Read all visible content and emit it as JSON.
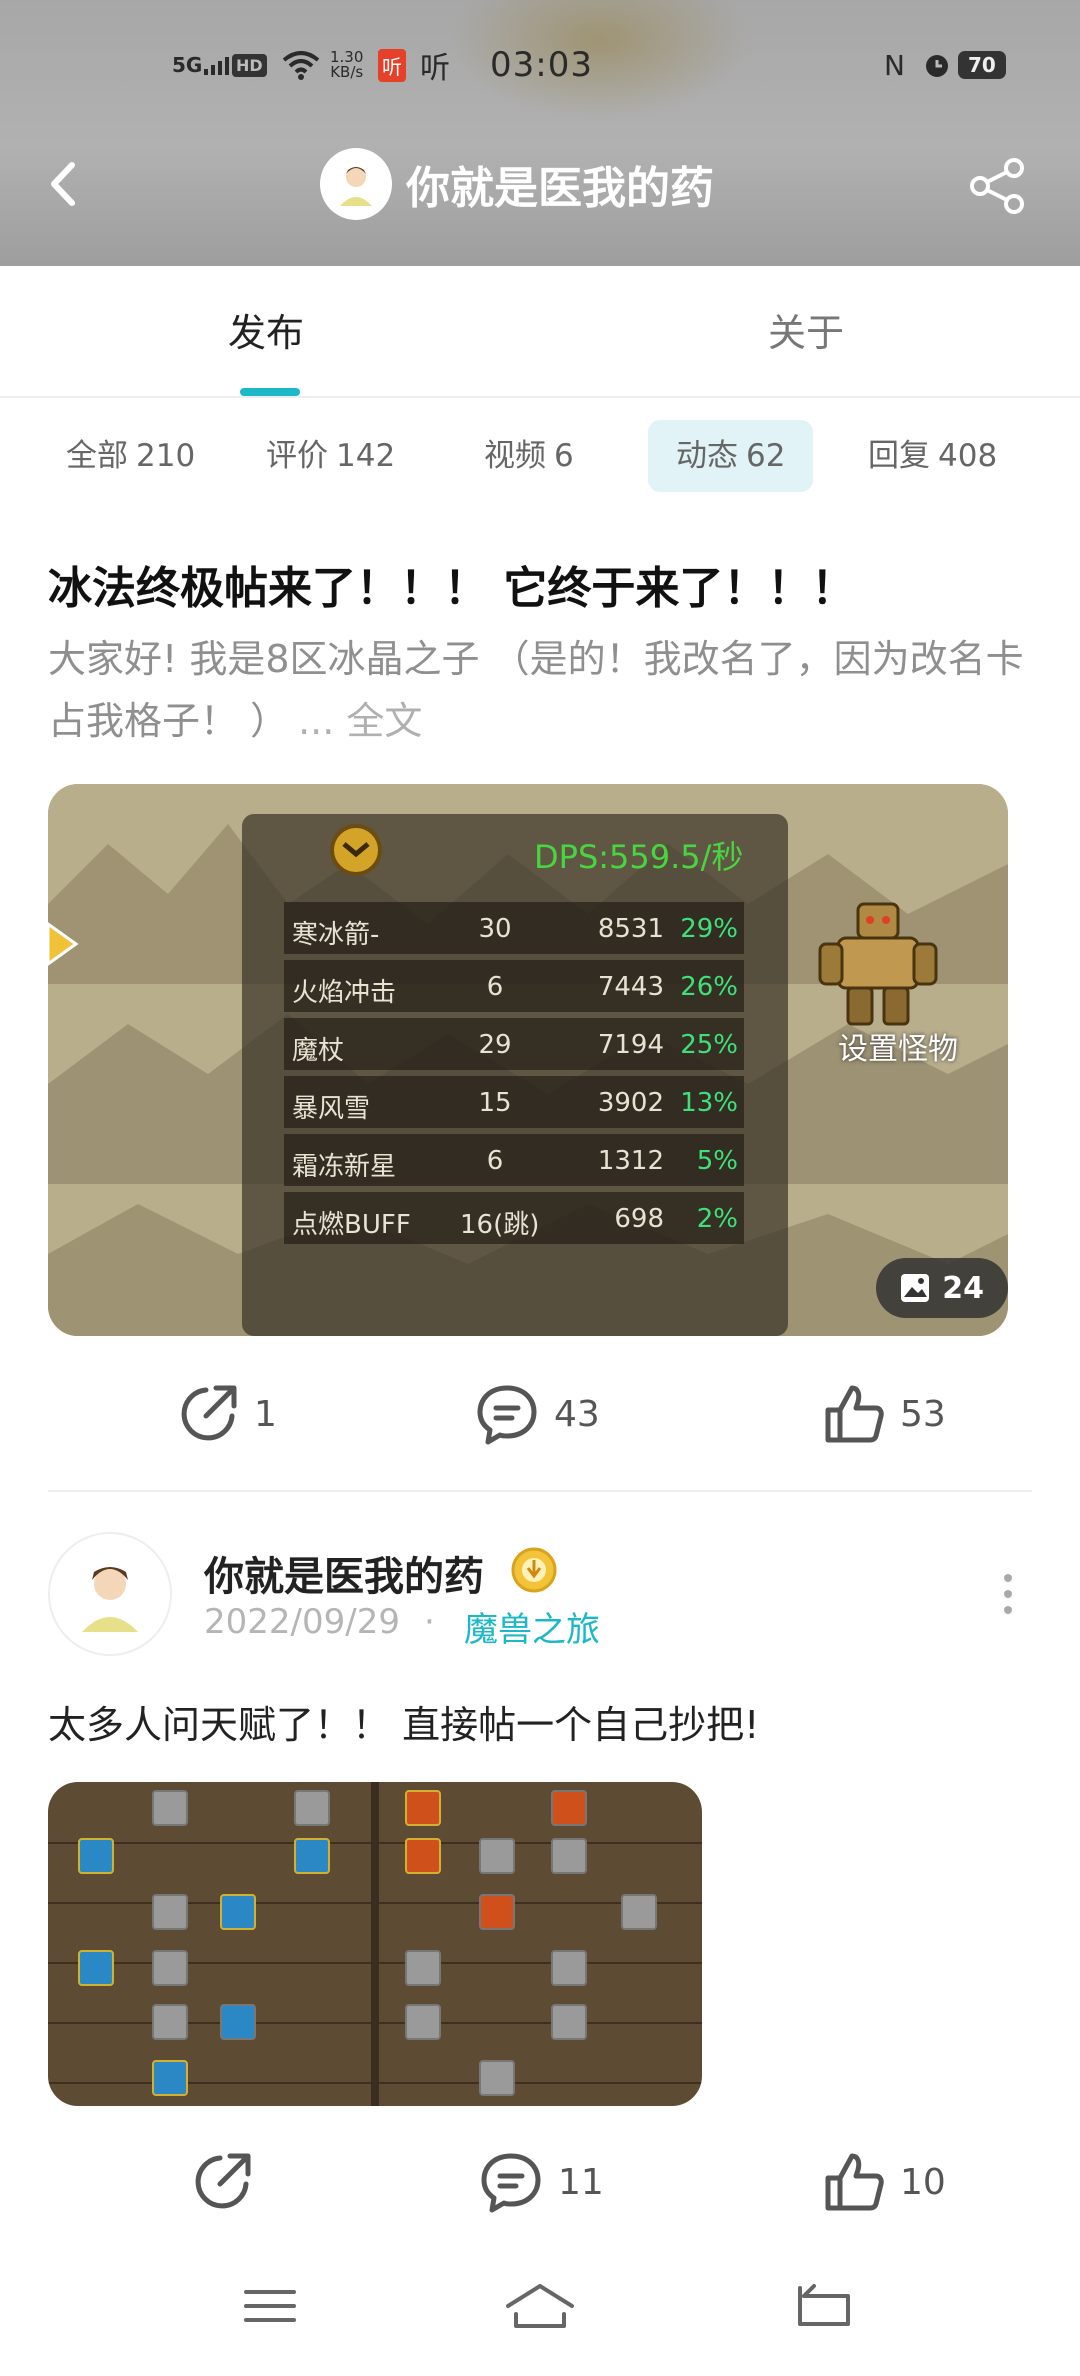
{
  "status_bar": {
    "signal": "5G",
    "hd": "HD",
    "speed_value": "1.30",
    "speed_unit": "KB/s",
    "app1": "听",
    "app2": "听",
    "time": "03:03",
    "nfc": "N",
    "battery": "70"
  },
  "header": {
    "title": "你就是医我的药",
    "icons": {
      "back": "back-arrow-icon",
      "share": "share-icon"
    }
  },
  "tabs": {
    "items": [
      "发布",
      "关于"
    ],
    "active": "发布"
  },
  "filters": [
    {
      "label": "全部",
      "count": "210",
      "active": false
    },
    {
      "label": "评价",
      "count": "142",
      "active": false
    },
    {
      "label": "视频",
      "count": "6",
      "active": false
    },
    {
      "label": "动态",
      "count": "62",
      "active": true
    },
    {
      "label": "回复",
      "count": "408",
      "active": false
    }
  ],
  "post1": {
    "title": "冰法终极帖来了！！！ 它终于来了！！！",
    "body": "大家好! 我是8区冰晶之子 （是的！我改名了，因为改名卡占我格子！ ）",
    "more_label": "... 全文",
    "image": {
      "dps_label": "DPS:559.5/秒",
      "rows": [
        {
          "name": "寒冰箭-",
          "count": "30",
          "damage": "8531",
          "percent": "29%"
        },
        {
          "name": "火焰冲击",
          "count": "6",
          "damage": "7443",
          "percent": "26%"
        },
        {
          "name": "魔杖",
          "count": "29",
          "damage": "7194",
          "percent": "25%"
        },
        {
          "name": "暴风雪",
          "count": "15",
          "damage": "3902",
          "percent": "13%"
        },
        {
          "name": "霜冻新星",
          "count": "6",
          "damage": "1312",
          "percent": "5%"
        },
        {
          "name": "点燃BUFF",
          "count": "16(跳)",
          "damage": "698",
          "percent": "2%"
        }
      ],
      "monster_label": "设置怪物",
      "image_count": "24"
    },
    "actions": {
      "share": "1",
      "comment": "43",
      "like": "53"
    }
  },
  "post2": {
    "author": "你就是医我的药",
    "date": "2022/09/29",
    "separator": "·",
    "topic": "魔兽之旅",
    "text": "太多人问天赋了！！ 直接帖一个自己抄把!",
    "actions": {
      "comment": "11",
      "like": "10"
    }
  },
  "colors": {
    "accent": "#1cb8c8",
    "chip_active_bg": "#e1f3f6",
    "percent_green": "#3fe07a",
    "dps_green": "#48d640"
  }
}
